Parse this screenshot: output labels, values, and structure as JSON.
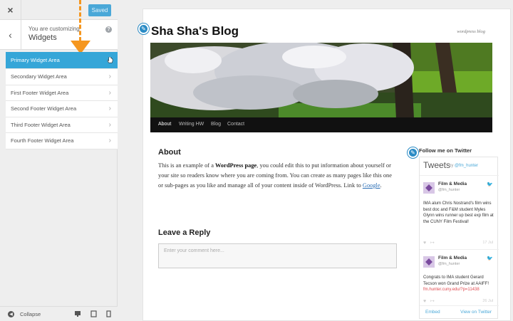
{
  "customizer": {
    "close_label": "×",
    "saved_label": "Saved",
    "back_label": "‹",
    "customizing_label": "You are customizing",
    "section_title": "Widgets",
    "help_label": "?",
    "widget_areas": [
      {
        "label": "Primary Widget Area"
      },
      {
        "label": "Secondary Widget Area"
      },
      {
        "label": "First Footer Widget Area"
      },
      {
        "label": "Second Footer Widget Area"
      },
      {
        "label": "Third Footer Widget Area"
      },
      {
        "label": "Fourth Footer Widget Area"
      }
    ],
    "collapse_label": "Collapse",
    "accent_color": "#35a6d8",
    "annotation_color": "#f5961e"
  },
  "site": {
    "title": "Sha Sha's Blog",
    "tagline": "wordpress blog",
    "nav": [
      "About",
      "Writing HW",
      "Blog",
      "Contact"
    ],
    "page": {
      "heading": "About",
      "text_before_bold": "This is an example of a ",
      "bold": "WordPress page",
      "text_after_bold": ", you could edit this to put information about yourself or your site so readers know where you are coming from. You can create as many pages like this one or sub-pages as you like and manage all of your content inside of WordPress. Link to ",
      "link": "Google",
      "text_end": "."
    },
    "reply": {
      "heading": "Leave a Reply",
      "placeholder": "Enter your comment here..."
    }
  },
  "twitter_widget": {
    "heading": "Follow me on Twitter",
    "title": "Tweets",
    "by_prefix": "by ",
    "by_handle": "@fm_hunter",
    "tweets": [
      {
        "name": "Film & Media",
        "handle": "@fm_hunter",
        "text": "IMA alum Chris Nostrand's film wins best doc and F&M student Myles Glynn wins runner up best exp film at the CUNY Film Festival!",
        "link": "",
        "time": "17 Jul"
      },
      {
        "name": "Film & Media",
        "handle": "@fm_hunter",
        "text": "Congrats to IMA student Gerard Tecson won Grand Prize at AAIFF! ",
        "link": "fm.hunter.cuny.edu/?p=11438",
        "time": "26 Jul"
      }
    ],
    "embed_label": "Embed",
    "view_label": "View on Twitter"
  }
}
